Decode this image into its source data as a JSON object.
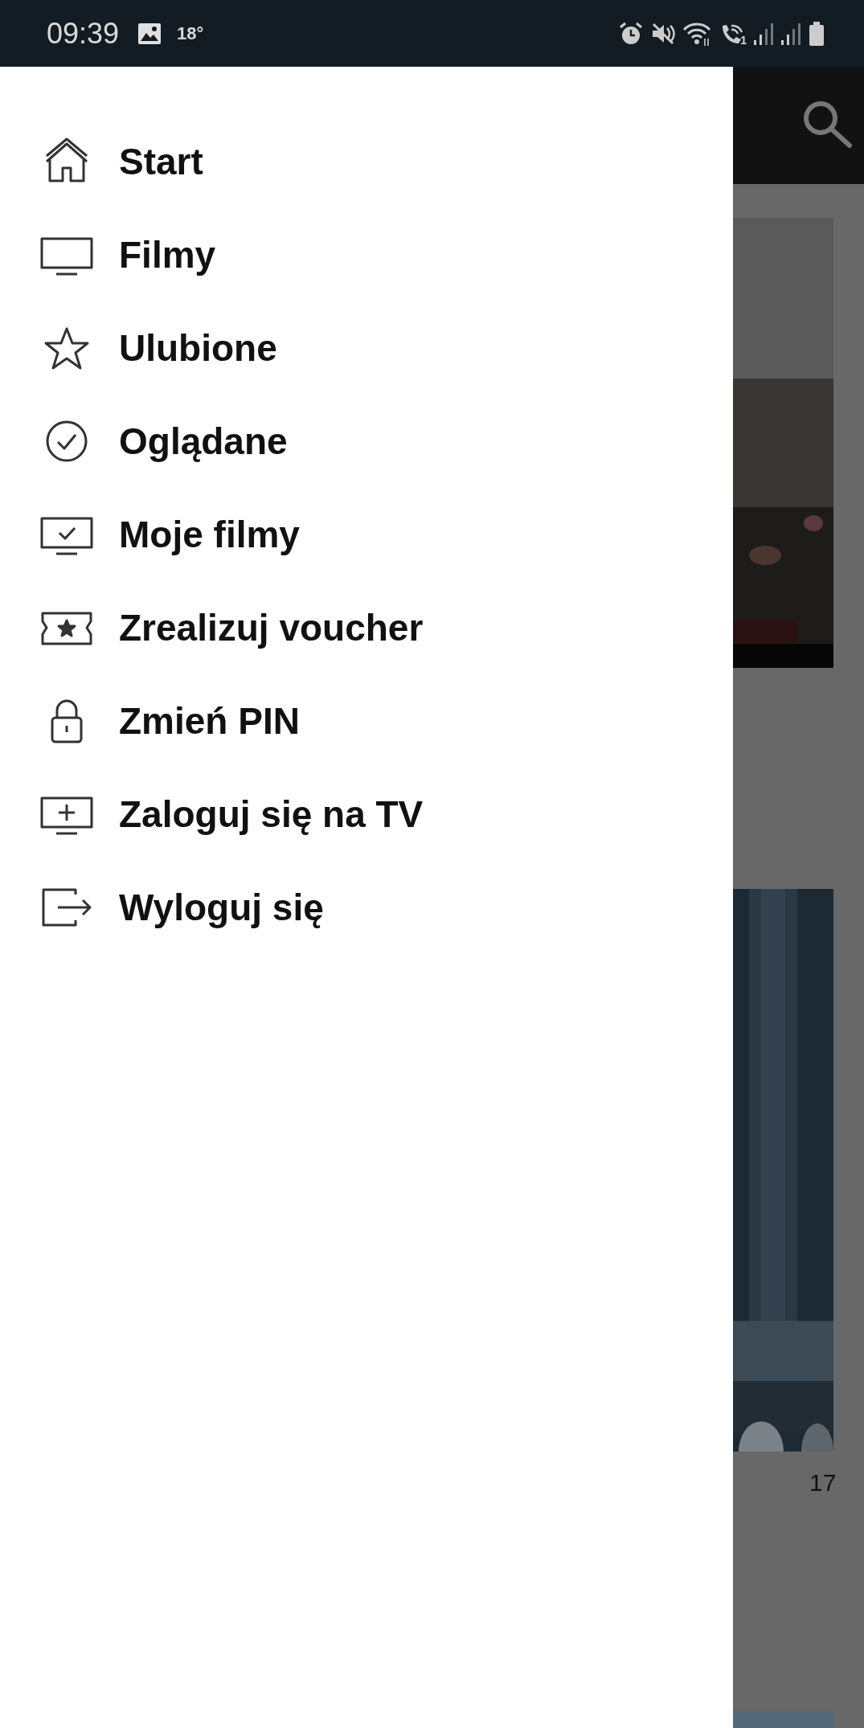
{
  "status_bar": {
    "time": "09:39",
    "temperature": "18°",
    "call_sim": "1"
  },
  "drawer": {
    "items": [
      {
        "label": "Start"
      },
      {
        "label": "Filmy"
      },
      {
        "label": "Ulubione"
      },
      {
        "label": "Oglądane"
      },
      {
        "label": "Moje filmy"
      },
      {
        "label": "Zrealizuj voucher"
      },
      {
        "label": "Zmień PIN"
      },
      {
        "label": "Zaloguj się na TV"
      },
      {
        "label": "Wyloguj się"
      }
    ]
  },
  "background_page": {
    "label": "17"
  }
}
